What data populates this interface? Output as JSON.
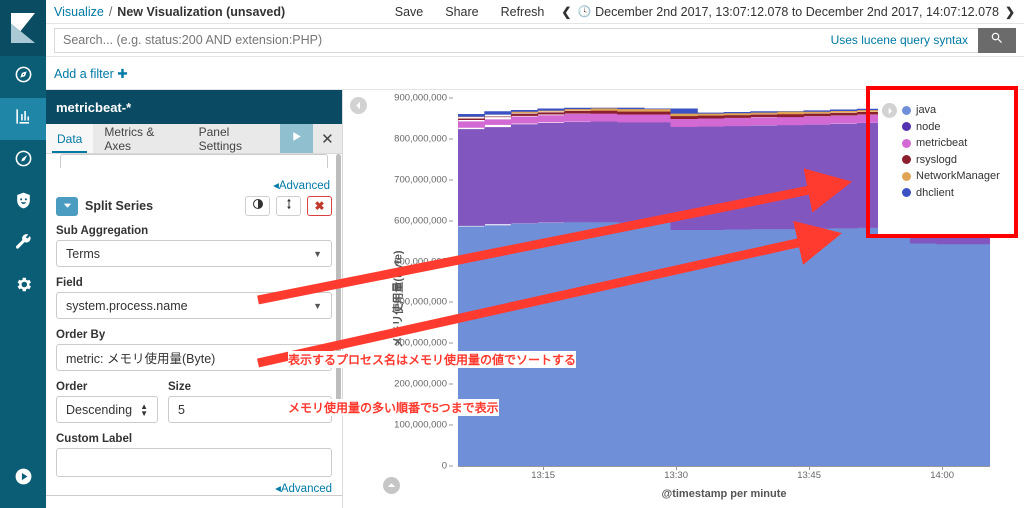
{
  "app": {
    "brand_icon": "kibana-logo"
  },
  "breadcrumb": {
    "root": "Visualize",
    "separator": "/",
    "current": "New Visualization (unsaved)"
  },
  "topbar": {
    "actions": [
      "Save",
      "Share",
      "Refresh"
    ],
    "prev_icon": "chevron-left-icon",
    "next_icon": "chevron-right-icon",
    "clock_icon": "clock-icon",
    "time_range": "December 2nd 2017, 13:07:12.078 to December 2nd 2017, 14:07:12.078"
  },
  "search": {
    "value": "",
    "placeholder": "Search... (e.g. status:200 AND extension:PHP)",
    "hint": "Uses lucene query syntax",
    "submit_icon": "search-icon"
  },
  "filterbar": {
    "add_filter": "Add a filter ✚"
  },
  "rail": {
    "items": [
      {
        "name": "discover",
        "icon": "compass-icon",
        "active": false
      },
      {
        "name": "visualize",
        "icon": "bar-chart-icon",
        "active": true
      },
      {
        "name": "dashboard",
        "icon": "clock-dashboard-icon",
        "active": false
      },
      {
        "name": "timelion",
        "icon": "shield-icon",
        "active": false
      },
      {
        "name": "dev-tools",
        "icon": "wrench-icon",
        "active": false
      },
      {
        "name": "management",
        "icon": "gear-icon",
        "active": false
      }
    ],
    "bottom": {
      "name": "collapse-nav",
      "icon": "play-circle-icon"
    }
  },
  "sidebar": {
    "index_pattern": "metricbeat-*",
    "tabs": [
      {
        "label": "Data",
        "active": true
      },
      {
        "label": "Metrics & Axes",
        "active": false
      },
      {
        "label": "Panel Settings",
        "active": false
      }
    ],
    "apply_icon": "play-icon",
    "close_icon": "close-icon",
    "advanced_top": "◂Advanced",
    "advanced_bottom": "◂Advanced",
    "bucket": {
      "title": "Split Series",
      "caret_icon": "caret-down-icon",
      "toggle_icon": "toggle-icon",
      "move_icon": "move-updown-icon",
      "remove_icon": "remove-x-icon",
      "sub_aggregation_label": "Sub Aggregation",
      "sub_aggregation_value": "Terms",
      "field_label": "Field",
      "field_value": "system.process.name",
      "order_by_label": "Order By",
      "order_by_value": "metric: メモリ使用量(Byte)",
      "order_label": "Order",
      "order_value": "Descending",
      "size_label": "Size",
      "size_value": "5",
      "custom_label_label": "Custom Label",
      "custom_label_value": ""
    }
  },
  "chart_panel": {
    "collapse_icon": "chevron-left-circle-icon",
    "expand_icon": "chevron-up-circle-icon",
    "legend_toggle_icon": "chevron-right-circle-icon"
  },
  "annotations": {
    "box_color": "#ff0000",
    "arrow_color": "#ff3b30",
    "note_1": "表示するプロセス名はメモリ使用量の値でソートする",
    "note_2": "メモリ使用量の多い順番で5つまで表示"
  },
  "chart_data": {
    "type": "area",
    "title": "",
    "xlabel": "@timestamp per minute",
    "ylabel": "メモリ使用量(Byte)",
    "ylim": [
      0,
      900000000
    ],
    "yticks": [
      0,
      100000000,
      200000000,
      300000000,
      400000000,
      500000000,
      600000000,
      700000000,
      800000000,
      900000000
    ],
    "ytick_labels": [
      "0",
      "100,000,000",
      "200,000,000",
      "300,000,000",
      "400,000,000",
      "500,000,000",
      "600,000,000",
      "700,000,000",
      "800,000,000",
      "900,000,000"
    ],
    "xticks": [
      "13:15",
      "13:30",
      "13:45",
      "14:00"
    ],
    "xtick_positions": [
      0.16,
      0.41,
      0.66,
      0.91
    ],
    "grid": false,
    "stacked": true,
    "legend_position": "top-right",
    "x": [
      0,
      0.05,
      0.1,
      0.15,
      0.2,
      0.25,
      0.3,
      0.35,
      0.4,
      0.45,
      0.5,
      0.55,
      0.6,
      0.65,
      0.7,
      0.75,
      0.8,
      0.85,
      0.9,
      0.95,
      1.0
    ],
    "series": [
      {
        "name": "java",
        "color": "#6f8fd8",
        "values": [
          585000000,
          588000000,
          592000000,
          594000000,
          596000000,
          597000000,
          597000000,
          596000000,
          596000000,
          578000000,
          578000000,
          579000000,
          580000000,
          580000000,
          581000000,
          582000000,
          583000000,
          570000000,
          545000000,
          543000000,
          543000000
        ]
      },
      {
        "name": "node",
        "color": "#8256bf",
        "values": [
          238000000,
          240000000,
          243000000,
          244000000,
          245000000,
          246000000,
          246000000,
          245000000,
          245000000,
          252000000,
          253000000,
          253000000,
          254000000,
          254000000,
          255000000,
          256000000,
          257000000,
          253000000,
          245000000,
          244000000,
          244000000
        ]
      },
      {
        "name": "metricbeat",
        "color": "#d369d3",
        "values": [
          19000000,
          19000000,
          19000000,
          19000000,
          19500000,
          19500000,
          19500000,
          19500000,
          19500000,
          19500000,
          19500000,
          20000000,
          20000000,
          20000000,
          20000000,
          20000000,
          20000000,
          19000000,
          18000000,
          18000000,
          18000000
        ]
      },
      {
        "name": "rsyslogd",
        "color": "#8b1f2e",
        "values": [
          7000000,
          7000000,
          7000000,
          7000000,
          7000000,
          7000000,
          7000000,
          7000000,
          7000000,
          7000000,
          7000000,
          7000000,
          7000000,
          7000000,
          7000000,
          7000000,
          7000000,
          7000000,
          6500000,
          6500000,
          6500000
        ]
      },
      {
        "name": "NetworkManager",
        "color": "#e0a455",
        "values": [
          6000000,
          6000000,
          6000000,
          6000000,
          6000000,
          6000000,
          6000000,
          6000000,
          6000000,
          6000000,
          6000000,
          6000000,
          6000000,
          6000000,
          6000000,
          6000000,
          6000000,
          6000000,
          6000000,
          6000000,
          6000000
        ]
      },
      {
        "name": "dhclient",
        "color": "#3b52c4",
        "values": [
          0,
          0,
          0,
          0,
          0,
          0,
          0,
          0,
          0,
          0,
          0,
          0,
          0,
          0,
          0,
          0,
          0,
          18000000,
          44000000,
          45000000,
          45000000
        ]
      }
    ],
    "legend": [
      {
        "label": "java",
        "color": "#6f8fd8"
      },
      {
        "label": "node",
        "color": "#5432b0"
      },
      {
        "label": "metricbeat",
        "color": "#d369d3"
      },
      {
        "label": "rsyslogd",
        "color": "#8b1f2e"
      },
      {
        "label": "NetworkManager",
        "color": "#e0a455"
      },
      {
        "label": "dhclient",
        "color": "#3b52c4"
      }
    ]
  }
}
